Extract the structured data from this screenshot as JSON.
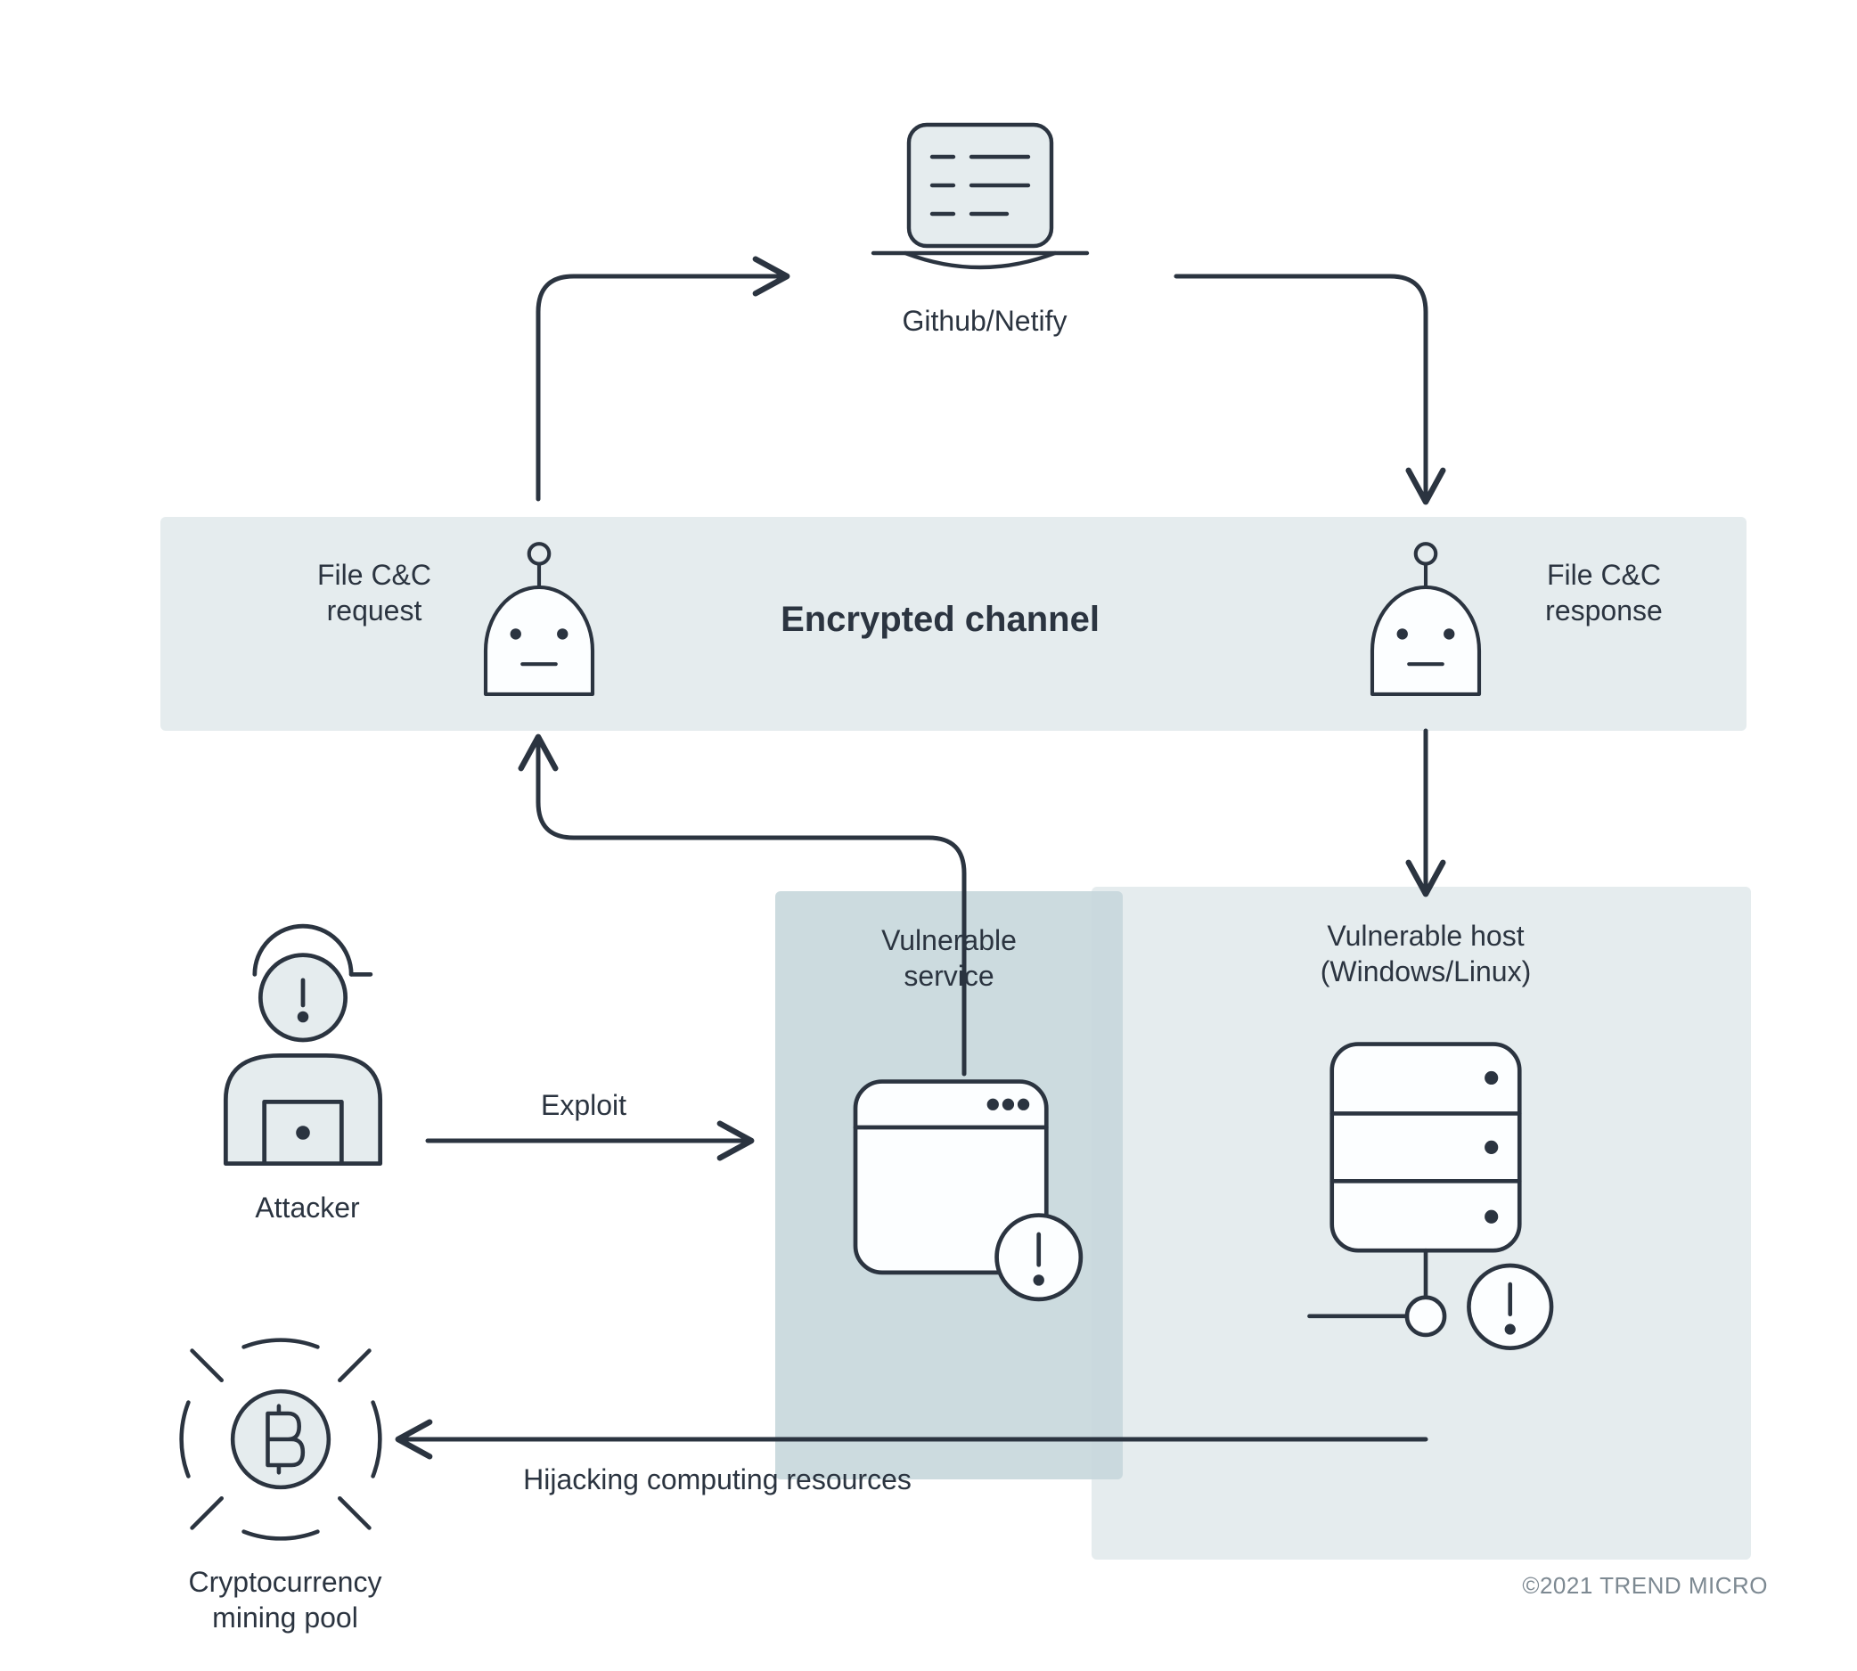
{
  "labels": {
    "github_netify": "Github/Netify",
    "file_cc_request_l1": "File C&C",
    "file_cc_request_l2": "request",
    "encrypted_channel": "Encrypted channel",
    "file_cc_response_l1": "File C&C",
    "file_cc_response_l2": "response",
    "attacker": "Attacker",
    "exploit": "Exploit",
    "vulnerable_service_l1": "Vulnerable",
    "vulnerable_service_l2": "service",
    "vulnerable_host_l1": "Vulnerable host",
    "vulnerable_host_l2": "(Windows/Linux)",
    "crypto_pool_l1": "Cryptocurrency",
    "crypto_pool_l2": "mining pool",
    "hijacking": "Hijacking computing resources"
  },
  "copyright": "©2021 TREND MICRO"
}
